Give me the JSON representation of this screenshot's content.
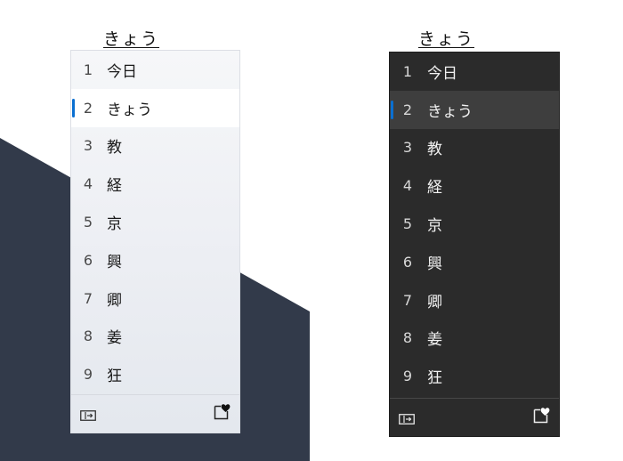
{
  "composition": {
    "text": "きょう"
  },
  "candidates": [
    {
      "num": "1",
      "word": "今日"
    },
    {
      "num": "2",
      "word": "きょう"
    },
    {
      "num": "3",
      "word": "教"
    },
    {
      "num": "4",
      "word": "経"
    },
    {
      "num": "5",
      "word": "京"
    },
    {
      "num": "6",
      "word": "興"
    },
    {
      "num": "7",
      "word": "卿"
    },
    {
      "num": "8",
      "word": "姜"
    },
    {
      "num": "9",
      "word": "狂"
    }
  ],
  "selected_index": 2,
  "footer": {
    "left_icon": "expand-candidates-icon",
    "right_icon": "favorite-icon"
  },
  "colors": {
    "accent": "#0a6fd1",
    "background_shape": "#323a4a",
    "light_panel": "#eceef3",
    "dark_panel": "#2b2b2b"
  }
}
